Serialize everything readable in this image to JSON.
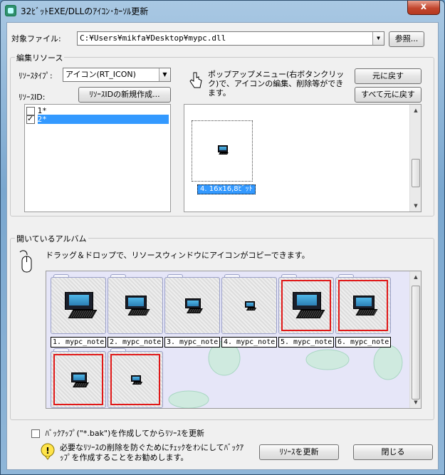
{
  "window": {
    "title": "32ﾋﾞｯﾄEXE/DLLのｱｲｺﾝ･ｶｰｿﾙ更新",
    "close": "x"
  },
  "file": {
    "label": "対象ファイル:",
    "path": "C:¥Users¥mikfa¥Desktop¥mypc.dll",
    "browse": "参照..."
  },
  "edit": {
    "group_label": "編集リソース",
    "type_label": "ﾘｿｰｽﾀｲﾌﾟ:",
    "type_value": "アイコン(RT_ICON)",
    "id_label": "ﾘｿｰｽID:",
    "new_id_button": "ﾘｿｰｽIDの新規作成...",
    "ids": [
      {
        "label": "1*",
        "checked": false
      },
      {
        "label": "2*",
        "checked": true
      }
    ],
    "hint": "ポップアップメニュー(右ボタンクリック)で、アイコンの編集、削除等ができます。",
    "revert_button": "元に戻す",
    "revert_all_button": "すべて元に戻す",
    "selected_icon_caption": "4. 16x16,8ﾋﾞｯﾄ"
  },
  "album": {
    "group_label": "開いているアルバム",
    "hint": "ドラッグ＆ドロップで、リソースウィンドウにアイコンがコピーできます。",
    "items": [
      {
        "caption": "1. mypc_note",
        "selected": false
      },
      {
        "caption": "2. mypc_note",
        "selected": false
      },
      {
        "caption": "3. mypc_note",
        "selected": false
      },
      {
        "caption": "4. mypc_note",
        "selected": false
      },
      {
        "caption": "5. mypc_note",
        "selected": true
      },
      {
        "caption": "6. mypc_note",
        "selected": true
      },
      {
        "caption": "",
        "selected": true
      },
      {
        "caption": "",
        "selected": true
      }
    ]
  },
  "footer": {
    "backup_label": "ﾊﾞｯｸｱｯﾌﾟ(\"*.bak\")を作成してからﾘｿｰｽを更新",
    "backup_checked": false,
    "warning": "必要なﾘｿｰｽの削除を防ぐためにﾁｪｯｸをｵﾝにしてﾊﾞｯｸｱｯﾌﾟを作成することをお勧めします。",
    "update_button": "ﾘｿｰｽを更新",
    "close_button": "閉じる"
  },
  "colors": {
    "selection": "#3399ff",
    "album_bg": "#e6e6f8",
    "red_frame": "#e01818"
  }
}
